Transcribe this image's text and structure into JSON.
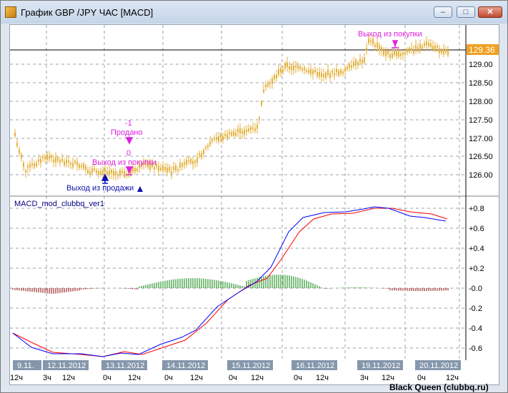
{
  "window": {
    "title": "График GBP /JPY  ЧАС [MACD]",
    "buttons": {
      "minimize": "–",
      "maximize": "□",
      "close": "✕"
    }
  },
  "price_panel": {
    "current_price": "129.36",
    "y_labels": [
      "129.50",
      "129.00",
      "128.50",
      "128.00",
      "127.50",
      "127.00",
      "126.50",
      "126.00"
    ],
    "annotations": [
      {
        "id": "buy-exit-top",
        "text": "Выход из покупки"
      },
      {
        "id": "qty-minus1",
        "text": "-1"
      },
      {
        "id": "sold",
        "text": "Продано"
      },
      {
        "id": "zero",
        "text": "0"
      },
      {
        "id": "buy-exit-low",
        "text": "Выход из покупки"
      },
      {
        "id": "sell-exit",
        "text": "Выход из продажи"
      }
    ]
  },
  "macd_panel": {
    "title": "MACD_mod_clubbq_ver1",
    "y_labels": [
      "+0.8",
      "+0.6",
      "+0.4",
      "+0.2",
      "-0.0",
      "-0.2",
      "-0.4",
      "-0.6"
    ]
  },
  "time_axis": {
    "dates": [
      "9.11.",
      "12.11.2012",
      "13.11.2012",
      "14.11.2012",
      "15.11.2012",
      "16.11.2012",
      "19.11.2012",
      "20.11.2012"
    ],
    "hours": [
      "12ч",
      "3ч",
      "12ч",
      "0ч",
      "12ч",
      "0ч",
      "12ч",
      "0ч",
      "12ч",
      "0ч",
      "12ч",
      "3ч",
      "12ч",
      "0ч",
      "12ч"
    ]
  },
  "watermark": "Black Queen (clubbq.ru)",
  "colors": {
    "candle": "#e3b23c",
    "annotation": "#e020e0",
    "sell_marker": "#1010b0",
    "macd_line": "#0000ff",
    "signal_line": "#ff0000",
    "hist_pos": "#008000",
    "hist_neg": "#8b0000",
    "price_badge": "#f0a020",
    "date_badge": "#8597ac"
  }
}
